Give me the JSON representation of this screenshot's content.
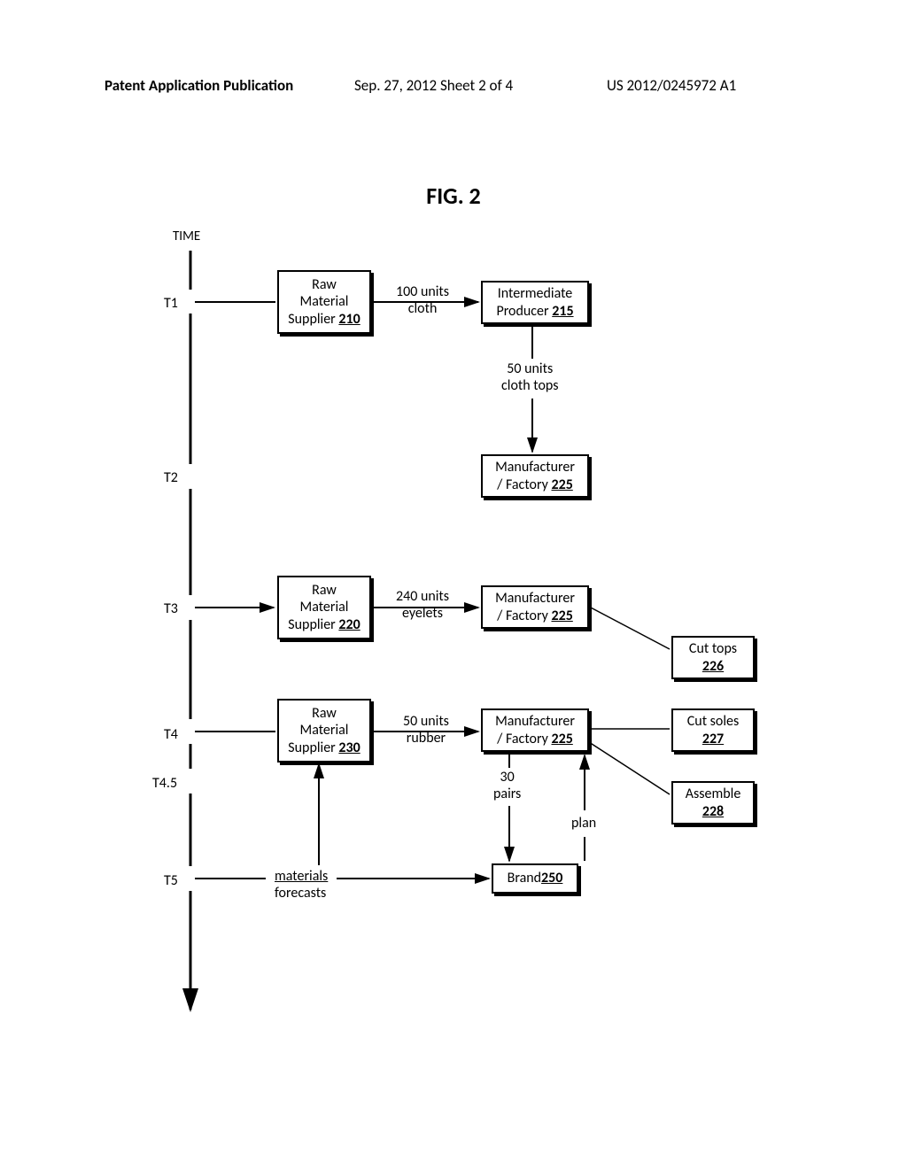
{
  "header": {
    "left": "Patent Application Publication",
    "center": "Sep. 27, 2012  Sheet 2 of 4",
    "right": "US 2012/0245972 A1"
  },
  "figure_title": "FIG. 2",
  "time_axis": {
    "label": "TIME",
    "ticks": [
      "T1",
      "T2",
      "T3",
      "T4",
      "T4.5",
      "T5"
    ]
  },
  "boxes": {
    "supplier210": {
      "line1": "Raw",
      "line2": "Material",
      "line3": "Supplier ",
      "ref": "210"
    },
    "producer215": {
      "line1": "Intermediate",
      "line2": "Producer ",
      "ref": "215"
    },
    "factoryA225": {
      "line1": "Manufacturer",
      "line2": "/ Factory ",
      "ref": "225"
    },
    "supplier220": {
      "line1": "Raw",
      "line2": "Material",
      "line3": "Supplier ",
      "ref": "220"
    },
    "factoryB225": {
      "line1": "Manufacturer",
      "line2": "/ Factory ",
      "ref": "225"
    },
    "supplier230": {
      "line1": "Raw",
      "line2": "Material",
      "line3": "Supplier ",
      "ref": "230"
    },
    "factoryC225": {
      "line1": "Manufacturer",
      "line2": "/ Factory ",
      "ref": "225"
    },
    "cuttops226": {
      "line1": "Cut tops",
      "ref": "226"
    },
    "cutsoles227": {
      "line1": "Cut soles",
      "ref": "227"
    },
    "assemble228": {
      "line1": "Assemble",
      "ref": "228"
    },
    "brand250": {
      "line1": "Brand ",
      "ref": "250"
    }
  },
  "edge_labels": {
    "cloth": {
      "l1": "100 units",
      "l2": "cloth"
    },
    "clothtops": {
      "l1": "50 units",
      "l2": "cloth tops"
    },
    "eyelets": {
      "l1": "240 units",
      "l2": "eyelets"
    },
    "rubber": {
      "l1": "50 units",
      "l2": "rubber"
    },
    "pairs": {
      "l1": "30",
      "l2": "pairs"
    },
    "plan": "plan",
    "materials": "materials",
    "forecasts": "forecasts"
  },
  "chart_data": {
    "type": "diagram",
    "title": "FIG. 2",
    "time_axis": [
      "T1",
      "T2",
      "T3",
      "T4",
      "T4.5",
      "T5"
    ],
    "nodes": [
      {
        "id": 210,
        "label": "Raw Material Supplier",
        "time": "T1"
      },
      {
        "id": 215,
        "label": "Intermediate Producer",
        "time": "T1"
      },
      {
        "id": 225,
        "label": "Manufacturer / Factory",
        "time": "T2"
      },
      {
        "id": 220,
        "label": "Raw Material Supplier",
        "time": "T3"
      },
      {
        "id": 225,
        "label": "Manufacturer / Factory",
        "time": "T3"
      },
      {
        "id": 230,
        "label": "Raw Material Supplier",
        "time": "T4"
      },
      {
        "id": 225,
        "label": "Manufacturer / Factory",
        "time": "T4"
      },
      {
        "id": 226,
        "label": "Cut tops"
      },
      {
        "id": 227,
        "label": "Cut soles"
      },
      {
        "id": 228,
        "label": "Assemble"
      },
      {
        "id": 250,
        "label": "Brand",
        "time": "T5"
      }
    ],
    "edges": [
      {
        "from": 210,
        "to": 215,
        "label": "100 units cloth",
        "time": "T1"
      },
      {
        "from": 215,
        "to": 225,
        "label": "50 units cloth tops",
        "time": "T2"
      },
      {
        "from": 220,
        "to": 225,
        "label": "240 units eyelets",
        "time": "T3"
      },
      {
        "from": 230,
        "to": 225,
        "label": "50 units rubber",
        "time": "T4"
      },
      {
        "from": 225,
        "to": 250,
        "label": "30 pairs"
      },
      {
        "from": 250,
        "to": 225,
        "label": "plan"
      },
      {
        "from": 250,
        "to": 230,
        "label": "materials forecasts",
        "time": "T5"
      },
      {
        "from": 225,
        "to": 226,
        "label": ""
      },
      {
        "from": 225,
        "to": 227,
        "label": ""
      },
      {
        "from": 225,
        "to": 228,
        "label": ""
      }
    ]
  }
}
